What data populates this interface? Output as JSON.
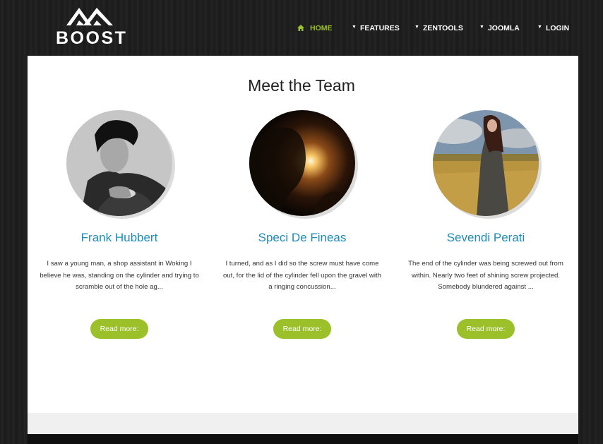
{
  "brand": {
    "name": "BOOST",
    "logo_icon": "mountain-icon"
  },
  "nav": {
    "items": [
      {
        "label": "HOME",
        "icon": "home-icon",
        "active": true
      },
      {
        "label": "FEATURES",
        "icon": "caret-down-icon"
      },
      {
        "label": "ZENTOOLS",
        "icon": "caret-down-icon"
      },
      {
        "label": "JOOMLA",
        "icon": "caret-down-icon"
      },
      {
        "label": "LOGIN",
        "icon": "caret-down-icon"
      }
    ]
  },
  "section": {
    "title": "Meet the Team"
  },
  "team": [
    {
      "name": "Frank Hubbert",
      "description": "I saw a young man, a shop assistant in Woking I believe he was, standing on the cylinder and trying to scramble out of the hole ag...",
      "button": "Read more:"
    },
    {
      "name": "Speci De Fineas",
      "description": "I turned, and as I did so the screw must have come out, for the lid of the cylinder fell upon the gravel with a ringing concussion...",
      "button": "Read more:"
    },
    {
      "name": "Sevendi Perati",
      "description": "The end of the cylinder was being screwed out from within. Nearly two feet of shining screw projected. Somebody blundered against ...",
      "button": "Read more:"
    }
  ],
  "colors": {
    "accent": "#9bc02a",
    "link": "#1e8bb5",
    "background": "#1c1c1c",
    "panel": "#ffffff"
  }
}
